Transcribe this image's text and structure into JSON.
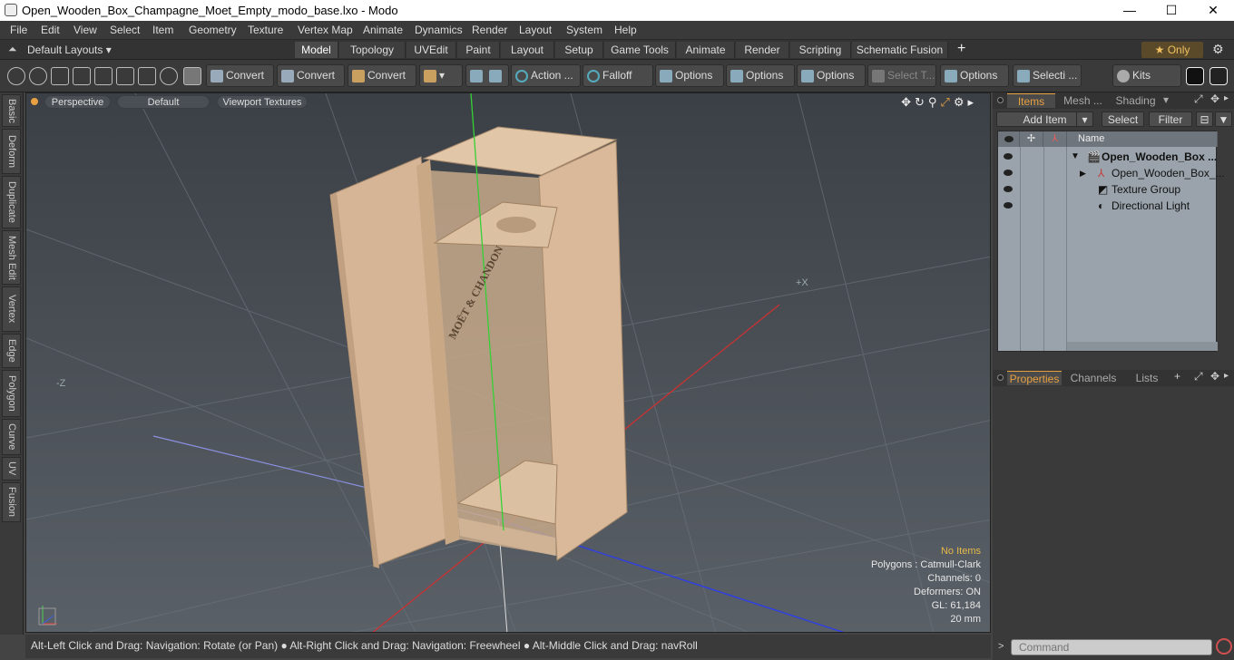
{
  "window": {
    "title": "Open_Wooden_Box_Champagne_Moet_Empty_modo_base.lxo - Modo",
    "minimize": "—",
    "maximize": "☐",
    "close": "✕"
  },
  "menu": [
    "File",
    "Edit",
    "View",
    "Select",
    "Item",
    "Geometry",
    "Texture",
    "Vertex Map",
    "Animate",
    "Dynamics",
    "Render",
    "Layout",
    "System",
    "Help"
  ],
  "layouts_label": "Default Layouts ▾",
  "tabs": [
    "Model",
    "Topology",
    "UVEdit",
    "Paint",
    "Layout",
    "Setup",
    "Game Tools",
    "Animate",
    "Render",
    "Scripting",
    "Schematic Fusion"
  ],
  "tab_add": "+",
  "only_label": "★  Only",
  "toolbar": {
    "convert1": "Convert",
    "convert2": "Convert",
    "convert3": "Convert",
    "action": "Action ...",
    "falloff": "Falloff",
    "options1": "Options",
    "options2": "Options",
    "options3": "Options",
    "select_t": "Select T...",
    "options4": "Options",
    "selecti": "Selecti ...",
    "kits": "Kits"
  },
  "left_tabs": [
    "Basic",
    "Deform",
    "Duplicate",
    "Mesh Edit",
    "Vertex",
    "Edge",
    "Polygon",
    "Curve",
    "UV",
    "Fusion"
  ],
  "viewport": {
    "perspective": "Perspective",
    "default": "Default",
    "textures": "Viewport Textures",
    "axis_x": "+X",
    "axis_z": "-Z",
    "brand": "MOËT & CHANDON",
    "stats": {
      "items": "No Items",
      "polygons": "Polygons : Catmull-Clark",
      "channels": "Channels: 0",
      "deformers": "Deformers: ON",
      "gl": "GL: 61,184",
      "size": "20 mm"
    }
  },
  "status_text": "Alt-Left Click and Drag: Navigation: Rotate (or Pan) ● Alt-Right Click and Drag: Navigation: Freewheel ● Alt-Middle Click and Drag: navRoll",
  "panel": {
    "tabs": [
      "Items",
      "Mesh ...",
      "Shading"
    ],
    "add_item": "Add Item",
    "select": "Select",
    "filter": "Filter",
    "name_col": "Name",
    "rows": [
      "Open_Wooden_Box ...",
      "Open_Wooden_Box_...",
      "Texture Group",
      "Directional Light"
    ],
    "prop_tabs": [
      "Properties",
      "Channels",
      "Lists"
    ],
    "command_placeholder": "Command"
  },
  "colors": {
    "accent": "#e8a040",
    "wood": "#d6b597",
    "viewport": "#545b62"
  }
}
